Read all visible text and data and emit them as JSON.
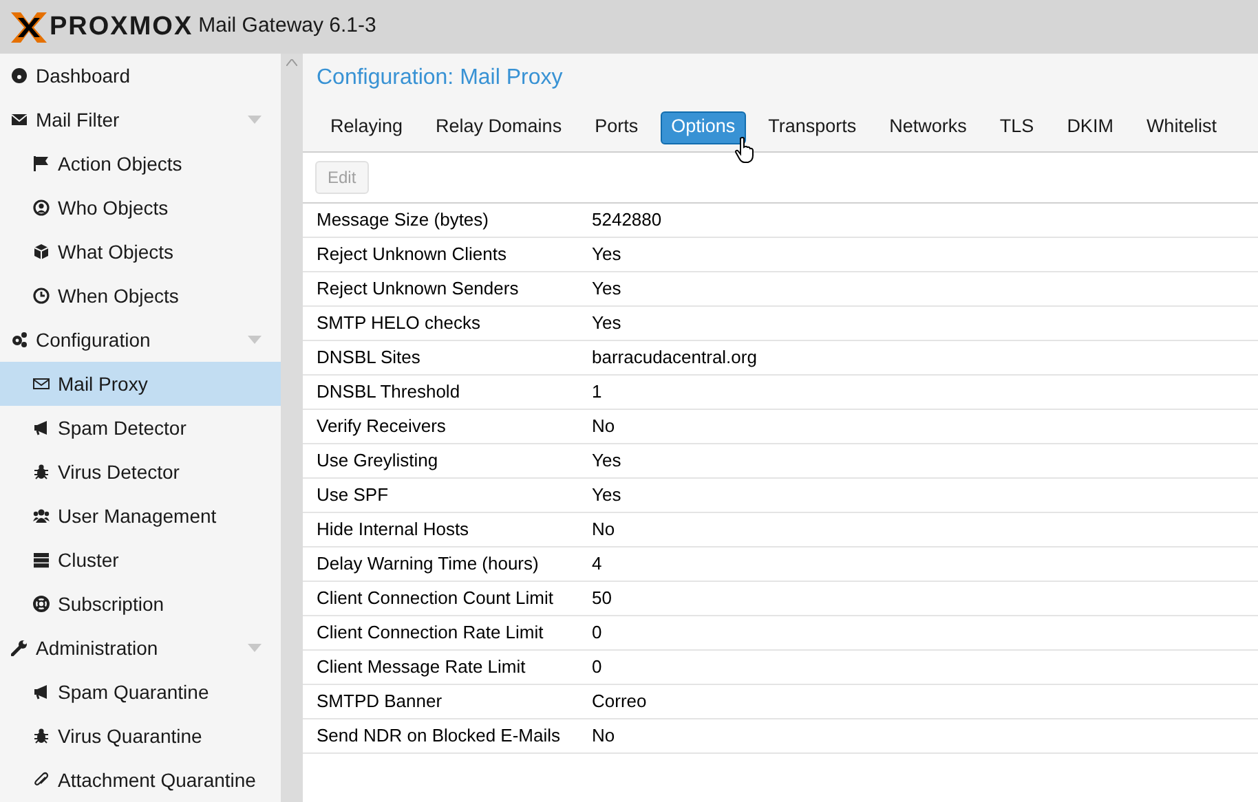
{
  "header": {
    "logo": "PROXMOX",
    "product": "Mail Gateway 6.1-3"
  },
  "sidebar": {
    "items": [
      {
        "label": "Dashboard",
        "selected": false
      },
      {
        "label": "Mail Filter",
        "selected": false,
        "expanded": true,
        "children": [
          {
            "label": "Action Objects",
            "selected": false
          },
          {
            "label": "Who Objects",
            "selected": false
          },
          {
            "label": "What Objects",
            "selected": false
          },
          {
            "label": "When Objects",
            "selected": false
          }
        ]
      },
      {
        "label": "Configuration",
        "selected": false,
        "expanded": true,
        "children": [
          {
            "label": "Mail Proxy",
            "selected": true
          },
          {
            "label": "Spam Detector",
            "selected": false
          },
          {
            "label": "Virus Detector",
            "selected": false
          },
          {
            "label": "User Management",
            "selected": false
          },
          {
            "label": "Cluster",
            "selected": false
          },
          {
            "label": "Subscription",
            "selected": false
          }
        ]
      },
      {
        "label": "Administration",
        "selected": false,
        "expanded": true,
        "children": [
          {
            "label": "Spam Quarantine",
            "selected": false
          },
          {
            "label": "Virus Quarantine",
            "selected": false
          },
          {
            "label": "Attachment Quarantine",
            "selected": false
          }
        ]
      }
    ]
  },
  "panel": {
    "title": "Configuration: Mail Proxy",
    "tabs": [
      {
        "label": "Relaying",
        "selected": false
      },
      {
        "label": "Relay Domains",
        "selected": false
      },
      {
        "label": "Ports",
        "selected": false
      },
      {
        "label": "Options",
        "selected": true
      },
      {
        "label": "Transports",
        "selected": false
      },
      {
        "label": "Networks",
        "selected": false
      },
      {
        "label": "TLS",
        "selected": false
      },
      {
        "label": "DKIM",
        "selected": false
      },
      {
        "label": "Whitelist",
        "selected": false
      }
    ],
    "toolbar": {
      "edit_button": {
        "label": "Edit",
        "disabled": true
      }
    },
    "rows": [
      {
        "name": "Message Size (bytes)",
        "value": "5242880"
      },
      {
        "name": "Reject Unknown Clients",
        "value": "Yes"
      },
      {
        "name": "Reject Unknown Senders",
        "value": "Yes"
      },
      {
        "name": "SMTP HELO checks",
        "value": "Yes"
      },
      {
        "name": "DNSBL Sites",
        "value": "barracudacentral.org"
      },
      {
        "name": "DNSBL Threshold",
        "value": "1"
      },
      {
        "name": "Verify Receivers",
        "value": "No"
      },
      {
        "name": "Use Greylisting",
        "value": "Yes"
      },
      {
        "name": "Use SPF",
        "value": "Yes"
      },
      {
        "name": "Hide Internal Hosts",
        "value": "No"
      },
      {
        "name": "Delay Warning Time (hours)",
        "value": "4"
      },
      {
        "name": "Client Connection Count Limit",
        "value": "50"
      },
      {
        "name": "Client Connection Rate Limit",
        "value": "0"
      },
      {
        "name": "Client Message Rate Limit",
        "value": "0"
      },
      {
        "name": "SMTPD Banner",
        "value": "Correo"
      },
      {
        "name": "Send NDR on Blocked E-Mails",
        "value": "No"
      }
    ]
  }
}
